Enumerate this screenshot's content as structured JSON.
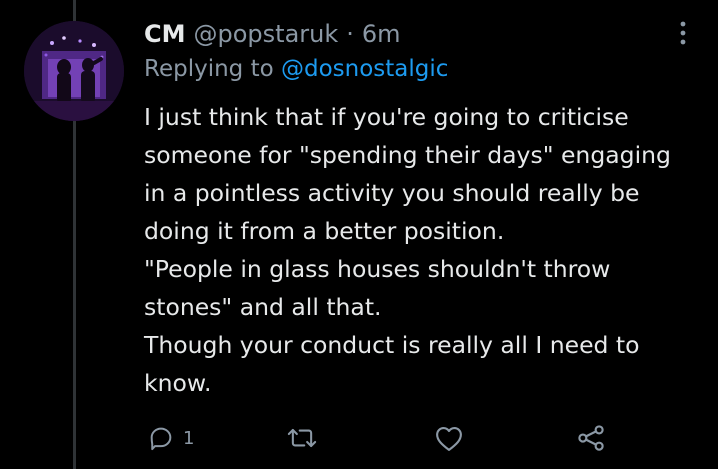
{
  "tweet": {
    "author_name": "CM",
    "author_handle": "@popstaruk",
    "separator": "·",
    "timestamp": "6m",
    "reply_prefix": "Replying to",
    "reply_to": "@dosnostalgic",
    "lines": [
      "I just think that if you're going to criticise",
      "someone for \"spending their days\" engaging",
      "in a pointless activity you should really be",
      "doing it from a better position.",
      "\"People in glass houses shouldn't throw",
      "stones\" and all that.",
      "Though your conduct is really all I need to",
      "know."
    ],
    "actions": {
      "reply_count": "1",
      "retweet_count": "",
      "like_count": ""
    }
  },
  "colors": {
    "background": "#000000",
    "primary_text": "#e7e9ea",
    "secondary_text": "#8b98a5",
    "link": "#1d9bf0",
    "thread_line": "#2f3336"
  },
  "icons": {
    "more": "more-dots-icon",
    "reply": "reply-bubble-icon",
    "retweet": "retweet-icon",
    "like": "heart-icon",
    "share": "share-icon"
  }
}
